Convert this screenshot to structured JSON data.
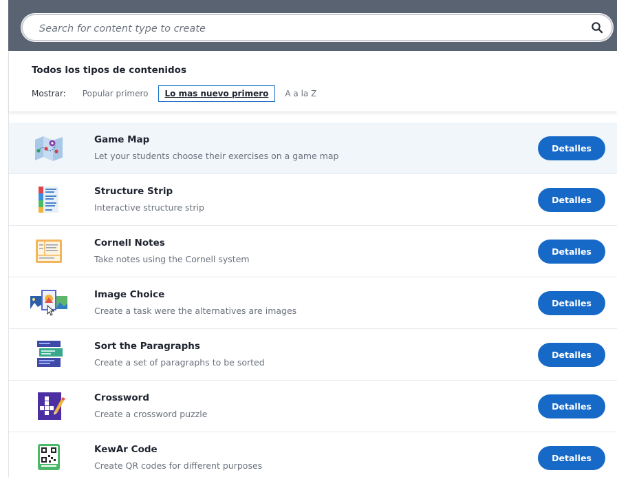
{
  "search": {
    "placeholder": "Search for content type to create",
    "value": ""
  },
  "header": {
    "title": "Todos los tipos de contenidos",
    "show_label": "Mostrar:",
    "sort_options": [
      {
        "label": "Popular primero",
        "active": false
      },
      {
        "label": "Lo mas nuevo primero",
        "active": true
      },
      {
        "label": "A a la Z",
        "active": false
      }
    ]
  },
  "items": [
    {
      "title": "Game Map",
      "description": "Let your students choose their exercises on a game map",
      "button": "Detalles",
      "icon": "game-map-icon"
    },
    {
      "title": "Structure Strip",
      "description": "Interactive structure strip",
      "button": "Detalles",
      "icon": "structure-strip-icon"
    },
    {
      "title": "Cornell Notes",
      "description": "Take notes using the Cornell system",
      "button": "Detalles",
      "icon": "cornell-notes-icon"
    },
    {
      "title": "Image Choice",
      "description": "Create a task were the alternatives are images",
      "button": "Detalles",
      "icon": "image-choice-icon"
    },
    {
      "title": "Sort the Paragraphs",
      "description": "Create a set of paragraphs to be sorted",
      "button": "Detalles",
      "icon": "sort-paragraphs-icon"
    },
    {
      "title": "Crossword",
      "description": "Create a crossword puzzle",
      "button": "Detalles",
      "icon": "crossword-icon"
    },
    {
      "title": "KewAr Code",
      "description": "Create QR codes for different purposes",
      "button": "Detalles",
      "icon": "qr-code-icon"
    }
  ],
  "colors": {
    "accent": "#1769c7",
    "search_bar_bg": "#5a6371",
    "highlight_row": "#f1f6fb"
  }
}
